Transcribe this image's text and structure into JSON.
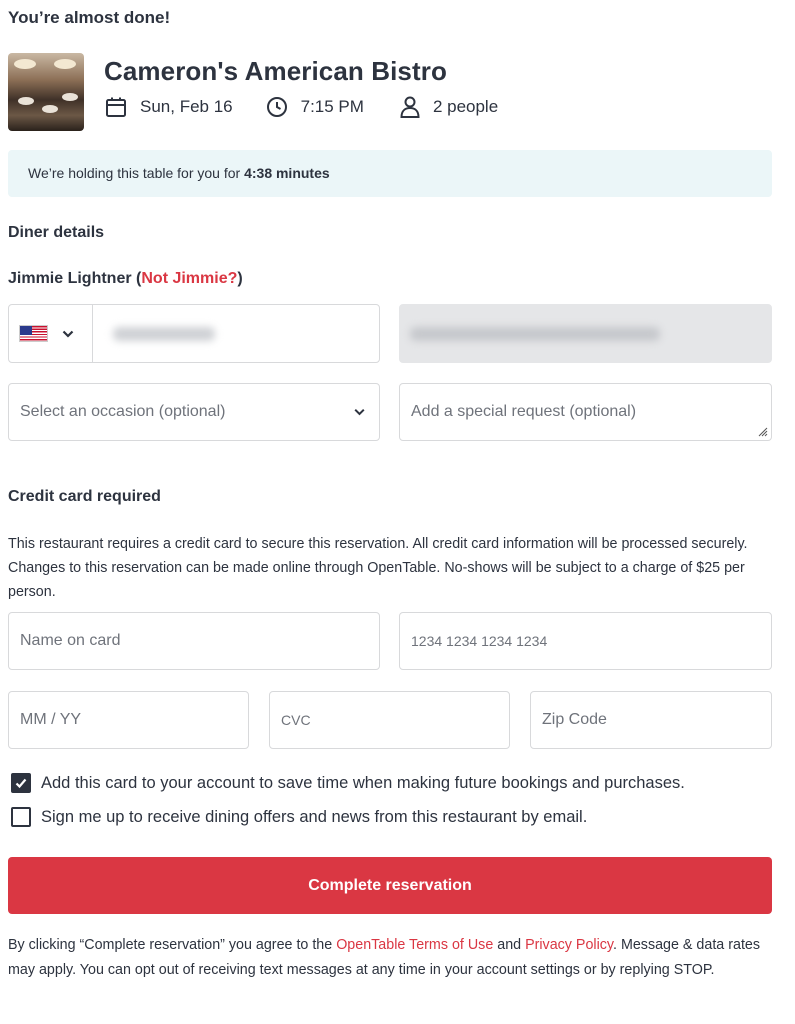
{
  "page": {
    "heading": "You’re almost done!"
  },
  "restaurant": {
    "name": "Cameron's American Bistro",
    "date": "Sun, Feb 16",
    "time": "7:15 PM",
    "party": "2 people"
  },
  "hold_banner": {
    "prefix": "We’re holding this table for you for ",
    "countdown": "4:38 minutes"
  },
  "diner": {
    "section_title": "Diner details",
    "name": "Jimmie Lightner",
    "open_paren": " (",
    "not_you_link": "Not Jimmie?",
    "close_paren": ")",
    "phone_country_icon": "us-flag-icon",
    "phone_value_hidden": true,
    "email_value_hidden": true,
    "occasion_placeholder": "Select an occasion (optional)",
    "special_request_placeholder": "Add a special request (optional)"
  },
  "credit_card": {
    "section_title": "Credit card required",
    "description": "This restaurant requires a credit card to secure this reservation. All credit card information will be processed securely. Changes to this reservation can be made online through OpenTable. No-shows will be subject to a charge of $25 per person.",
    "name_placeholder": "Name on card",
    "number_placeholder": "1234 1234 1234 1234",
    "expiry_placeholder": "MM / YY",
    "cvc_placeholder": "CVC",
    "zip_placeholder": "Zip Code"
  },
  "options": {
    "save_card_label": "Add this card to your account to save time when making future bookings and purchases.",
    "save_card_checked": true,
    "offers_label": "Sign me up to receive dining offers and news from this restaurant by email.",
    "offers_checked": false
  },
  "submit": {
    "label": "Complete reservation"
  },
  "legal": {
    "part1": "By clicking “Complete reservation” you agree to the ",
    "terms_link": "OpenTable Terms of Use",
    "and": " and ",
    "privacy_link": "Privacy Policy",
    "part2": ". Message & data rates may apply. You can opt out of receiving text messages at any time in your account settings or by replying STOP."
  },
  "colors": {
    "brand_red": "#da3743",
    "text": "#2d333f",
    "banner_bg": "#ebf6f8",
    "border": "#d8d9db"
  }
}
